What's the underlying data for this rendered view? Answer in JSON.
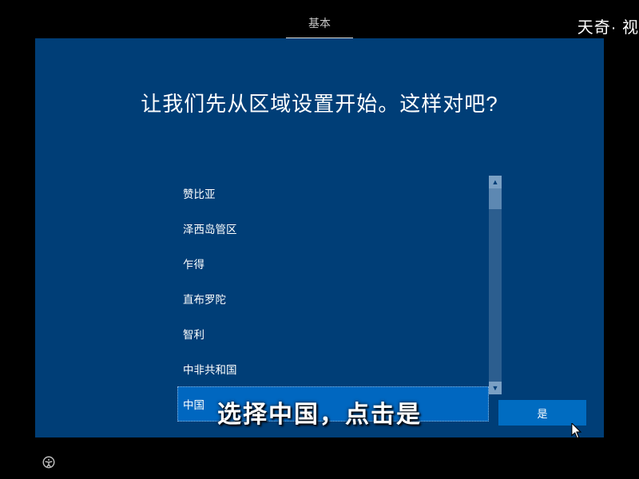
{
  "tab": {
    "label": "基本"
  },
  "watermark": "天奇· 视",
  "heading": "让我们先从区域设置开始。这样对吧?",
  "regions": {
    "items": [
      {
        "label": "赞比亚"
      },
      {
        "label": "泽西岛管区"
      },
      {
        "label": "乍得"
      },
      {
        "label": "直布罗陀"
      },
      {
        "label": "智利"
      },
      {
        "label": "中非共和国"
      },
      {
        "label": "中国"
      }
    ],
    "selected_index": 6
  },
  "confirm_button": "是",
  "subtitle": "选择中国，点击是"
}
